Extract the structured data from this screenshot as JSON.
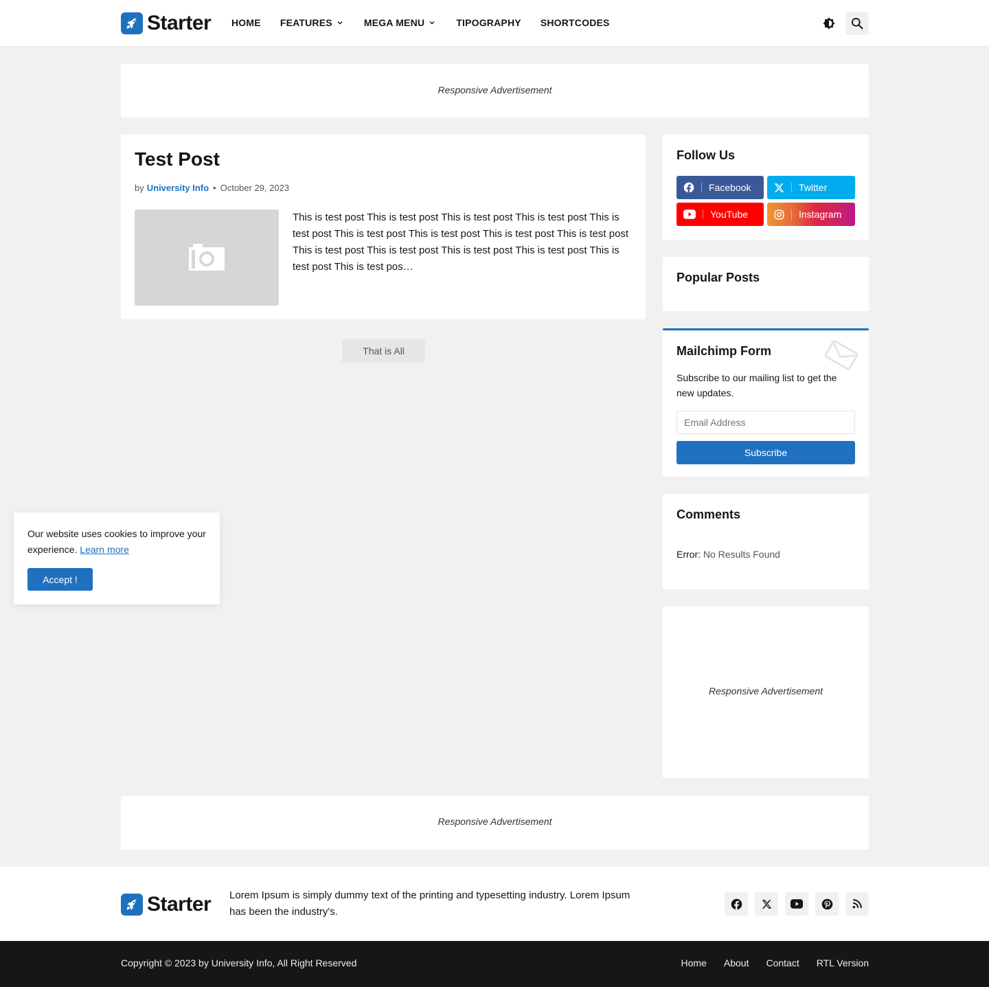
{
  "header": {
    "logo_text": "Starter",
    "nav": [
      "HOME",
      "FEATURES",
      "MEGA MENU",
      "TIPOGRAPHY",
      "SHORTCODES"
    ]
  },
  "ads": {
    "top": "Responsive Advertisement",
    "sidebar": "Responsive Advertisement",
    "bottom": "Responsive Advertisement"
  },
  "post": {
    "title": "Test Post",
    "by": "by",
    "author": "University Info",
    "dot": "•",
    "date": "October 29, 2023",
    "snippet": "This is test post This is test post This is test post This is test post This is test post This is test post This is test post This is test post This is test post This is test post This is test post This is test post This is test post This is test post This is test pos…"
  },
  "pager": {
    "label": "That is All"
  },
  "follow": {
    "title": "Follow Us",
    "buttons": [
      "Facebook",
      "Twitter",
      "YouTube",
      "Instagram"
    ]
  },
  "popular": {
    "title": "Popular Posts"
  },
  "mailchimp": {
    "title": "Mailchimp Form",
    "description": "Subscribe to our mailing list to get the new updates.",
    "email_placeholder": "Email Address",
    "subscribe_label": "Subscribe"
  },
  "comments": {
    "title": "Comments",
    "error_label": "Error:",
    "error_message": "No Results Found"
  },
  "cookie": {
    "text": "Our website uses cookies to improve your experience.",
    "learn_more": "Learn more",
    "accept": "Accept !"
  },
  "footer": {
    "logo_text": "Starter",
    "description": "Lorem Ipsum is simply dummy text of the printing and typesetting industry. Lorem Ipsum has been the industry's.",
    "copyright": "Copyright © 2023 by University Info, All Right Reserved",
    "links": [
      "Home",
      "About",
      "Contact",
      "RTL Version"
    ]
  },
  "colors": {
    "accent": "#1f71c0",
    "facebook": "#3b5998",
    "twitter": "#00acee",
    "youtube": "#ff0000",
    "instagram_from": "#f09433",
    "instagram_to": "#bc1888",
    "background": "#f1f1f1",
    "dark": "#161616"
  },
  "icons": {
    "header": [
      "dark-mode-icon",
      "search-icon"
    ],
    "footer_social": [
      "facebook-icon",
      "x-twitter-icon",
      "youtube-icon",
      "pinterest-icon",
      "rss-icon"
    ]
  }
}
